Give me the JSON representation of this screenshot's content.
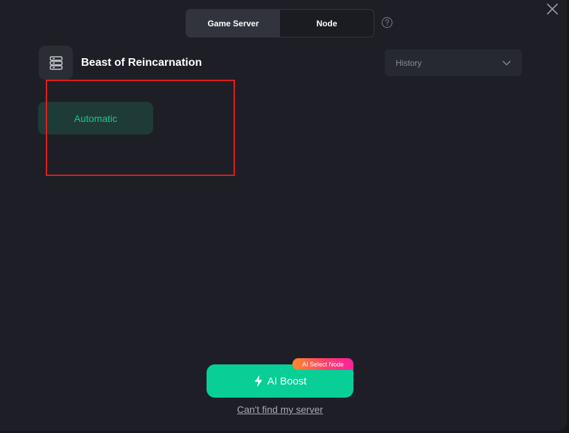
{
  "tabs": [
    {
      "label": "Game Server",
      "active": true
    },
    {
      "label": "Node",
      "active": false
    }
  ],
  "header": {
    "game_title": "Beast of Reincarnation",
    "server_icon": "server-stack-icon"
  },
  "history": {
    "label": "History",
    "icon": "chevron-down-icon"
  },
  "server_list": {
    "items": [
      {
        "label": "Automatic",
        "selected": true
      }
    ]
  },
  "boost": {
    "label": "AI Boost",
    "icon": "lightning-icon",
    "badge": "AI Select Node"
  },
  "footer": {
    "cant_find_label": "Can't find my server"
  },
  "colors": {
    "accent_green": "#08cf95",
    "automatic_text": "#19c98f",
    "highlight_red": "#e11d1d",
    "badge_orange": "#ff8a2a",
    "badge_pink": "#ff1fa0"
  }
}
